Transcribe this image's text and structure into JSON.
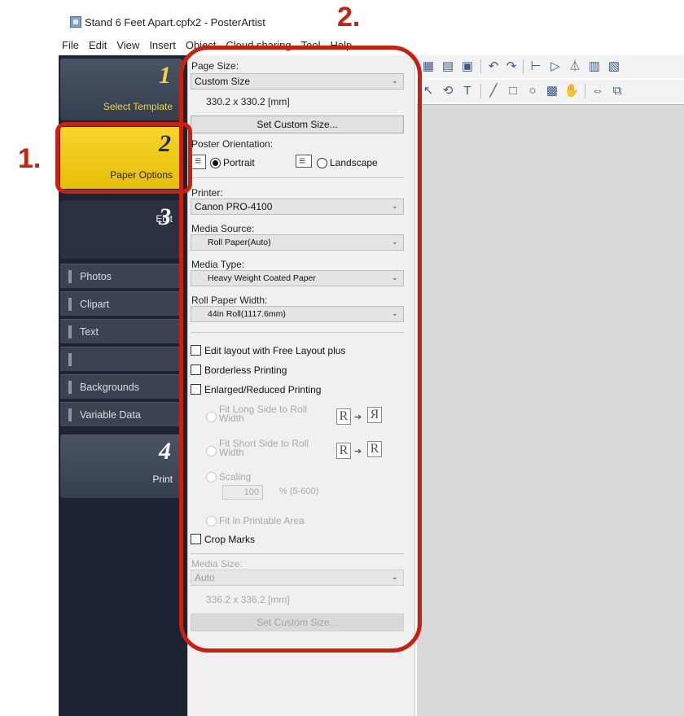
{
  "window": {
    "title": "Stand 6 Feet Apart.cpfx2 - PosterArtist"
  },
  "menu": [
    "File",
    "Edit",
    "View",
    "Insert",
    "Object",
    "Cloud sharing",
    "Tool",
    "Help"
  ],
  "nav": {
    "step1": {
      "num": "1",
      "label": "Select Template"
    },
    "step2": {
      "num": "2",
      "label": "Paper Options"
    },
    "step3": {
      "num": "3",
      "label": "Edit"
    },
    "subitems": [
      "Photos",
      "Clipart",
      "Text",
      "",
      "Backgrounds",
      "Variable Data"
    ],
    "step4": {
      "num": "4",
      "label": "Print"
    }
  },
  "annotations": {
    "one": "1.",
    "two": "2."
  },
  "panel": {
    "page_size_label": "Page Size:",
    "page_size_value": "Custom Size",
    "page_size_dims": "330.2 x 330.2 [mm]",
    "set_custom_size": "Set Custom Size...",
    "orientation_label": "Poster Orientation:",
    "portrait": "Portrait",
    "landscape": "Landscape",
    "printer_label": "Printer:",
    "printer_value": "Canon PRO-4100",
    "media_source_label": "Media Source:",
    "media_source_value": "Roll Paper(Auto)",
    "media_type_label": "Media Type:",
    "media_type_value": "Heavy Weight Coated Paper",
    "roll_width_label": "Roll Paper Width:",
    "roll_width_value": "44in Roll(1117.6mm)",
    "free_layout": "Edit layout with Free Layout plus",
    "borderless": "Borderless Printing",
    "enlarged": "Enlarged/Reduced Printing",
    "fit_long_1": "Fit Long Side to Roll",
    "fit_long_2": "Width",
    "fit_short_1": "Fit Short Side to Roll",
    "fit_short_2": "Width",
    "scaling": "Scaling",
    "scaling_value": "100",
    "scaling_range": "% (5-600)",
    "fit_printable": "Fit in Printable Area",
    "crop_marks": "Crop Marks",
    "media_size_label": "Media Size:",
    "media_size_value": "Auto",
    "media_size_dims": "336.2 x 336.2 [mm]",
    "set_custom_size_2": "Set Custom Size..."
  }
}
